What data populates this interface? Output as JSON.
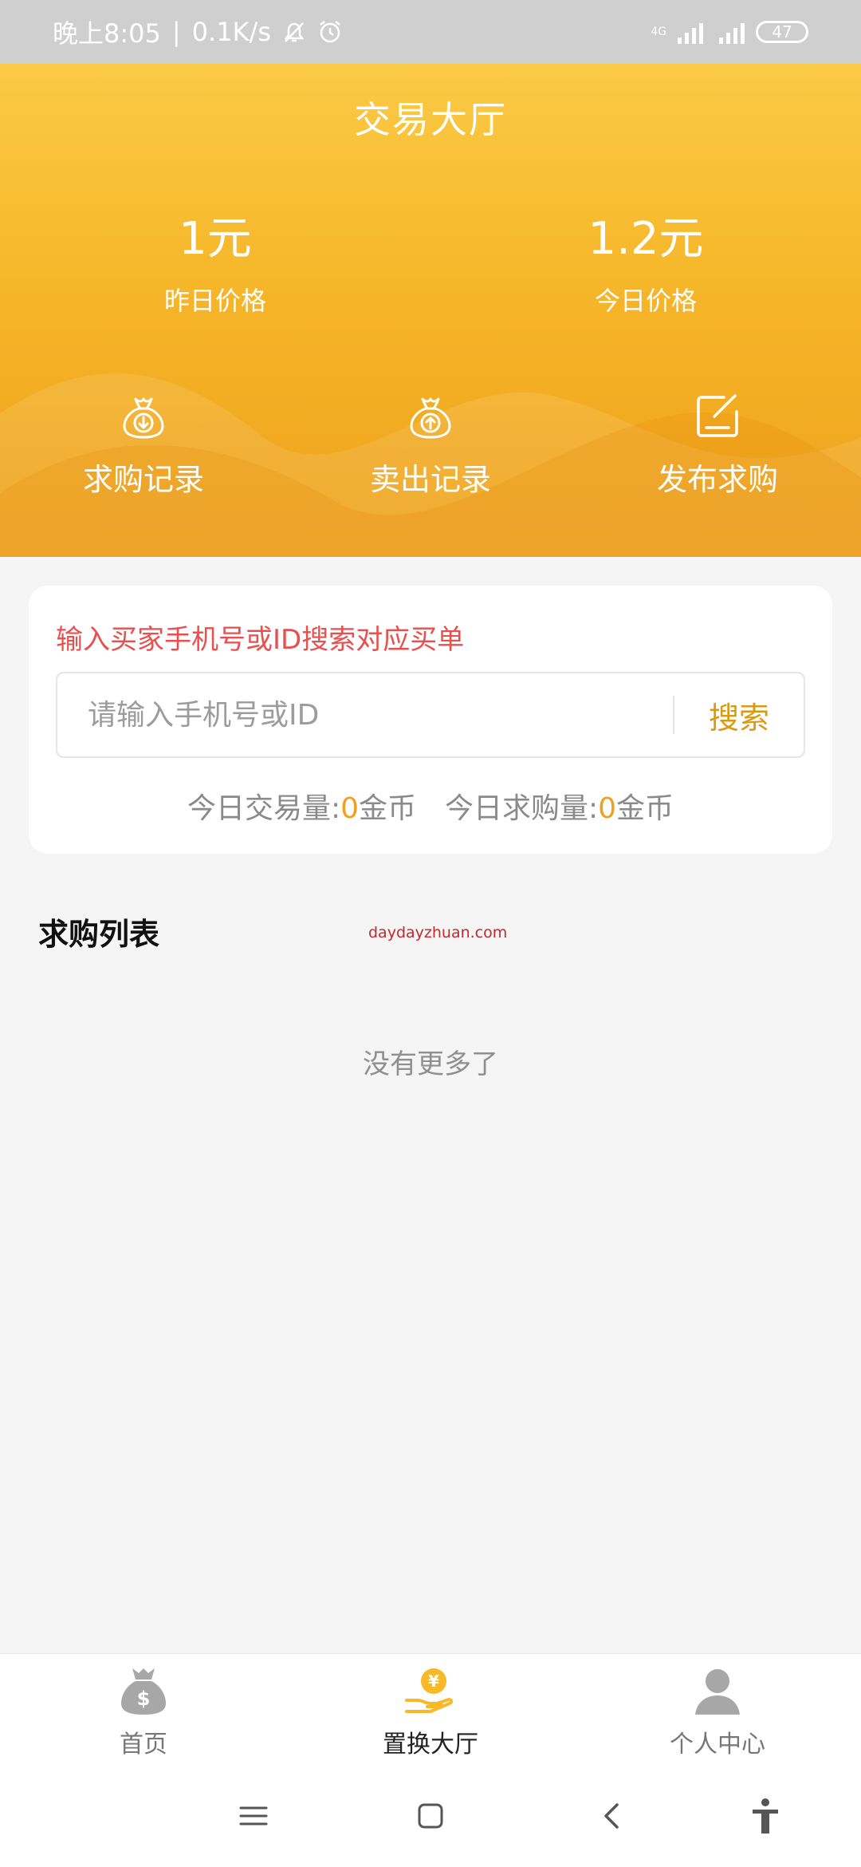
{
  "status_bar": {
    "time": "晚上8:05",
    "speed": "0.1K/s",
    "network": "4G",
    "battery": "47",
    "icons": [
      "mute-icon",
      "alarm-icon",
      "signal-icon",
      "signal-icon",
      "battery-icon"
    ]
  },
  "header": {
    "title": "交易大厅",
    "prices": [
      {
        "value": "1元",
        "label": "昨日价格"
      },
      {
        "value": "1.2元",
        "label": "今日价格"
      }
    ],
    "actions": [
      {
        "label": "求购记录",
        "icon": "bag-down-icon"
      },
      {
        "label": "卖出记录",
        "icon": "bag-up-icon"
      },
      {
        "label": "发布求购",
        "icon": "edit-icon"
      }
    ]
  },
  "search": {
    "hint": "输入买家手机号或ID搜索对应买单",
    "placeholder": "请输入手机号或ID",
    "button": "搜索"
  },
  "stats": {
    "trade_label": "今日交易量:",
    "trade_value": "0",
    "trade_unit": "金币",
    "buy_label": "今日求购量:",
    "buy_value": "0",
    "buy_unit": "金币"
  },
  "list": {
    "title": "求购列表",
    "watermark": "daydayzhuan.com",
    "empty_text": "没有更多了"
  },
  "tabbar": {
    "tabs": [
      {
        "label": "首页",
        "icon": "money-bag-icon",
        "active": false
      },
      {
        "label": "置换大厅",
        "icon": "coin-hand-icon",
        "active": true
      },
      {
        "label": "个人中心",
        "icon": "user-icon",
        "active": false
      }
    ]
  },
  "colors": {
    "header_top": "#fbca45",
    "header_bottom": "#eea11b",
    "accent": "#d99a12",
    "hint_red": "#e94f4f"
  }
}
